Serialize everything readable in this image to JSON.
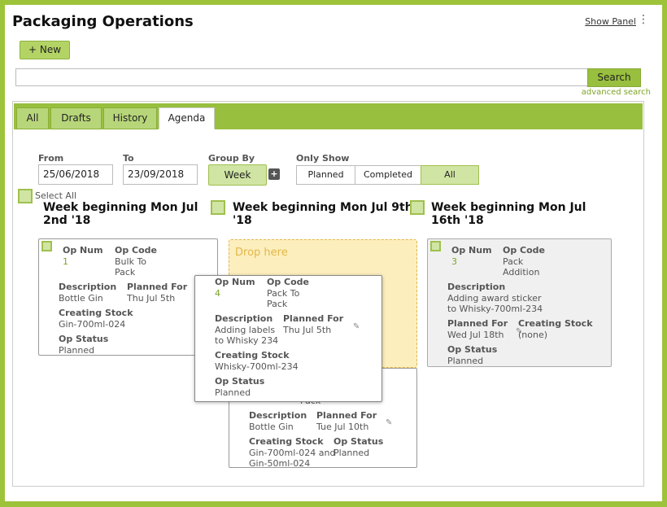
{
  "header": {
    "title": "Packaging Operations",
    "show_panel": "Show Panel",
    "new_label": "+ New"
  },
  "search": {
    "button": "Search",
    "advanced": "advanced search",
    "placeholder": ""
  },
  "tabs": [
    "All",
    "Drafts",
    "History",
    "Agenda"
  ],
  "filters": {
    "from_label": "From",
    "from_value": "25/06/2018",
    "to_label": "To",
    "to_value": "23/09/2018",
    "group_by_label": "Group By",
    "group_by_value": "Week",
    "plus": "+",
    "only_show_label": "Only Show",
    "only_show_options": [
      "Planned",
      "Completed",
      "All"
    ]
  },
  "select_all": "Select All",
  "drop_here": "Drop here",
  "weeks": [
    "Week beginning Mon Jul 2nd '18",
    "Week beginning Mon Jul 9th '18",
    "Week beginning Mon Jul 16th '18"
  ],
  "labels": {
    "op_num": "Op Num",
    "op_code": "Op Code",
    "description": "Description",
    "planned_for": "Planned For",
    "creating_stock": "Creating Stock",
    "op_status": "Op Status"
  },
  "cards": {
    "c1": {
      "num": "1",
      "code": "Bulk To Pack",
      "desc": "Bottle Gin",
      "planned": "Thu Jul 5th",
      "stock": "Gin-700ml-024",
      "status": "Planned"
    },
    "c4": {
      "num": "4",
      "code": "Pack To Pack",
      "desc": "Adding labels to Whisky 234",
      "planned": "Thu Jul 5th",
      "stock": "Whisky-700ml-234",
      "status": "Planned"
    },
    "c2": {
      "code_tail": "Pack",
      "desc": "Bottle Gin",
      "planned": "Tue Jul 10th",
      "stock": "Gin-700ml-024 and Gin-50ml-024",
      "status": "Planned"
    },
    "c3": {
      "num": "3",
      "code": "Pack Addition",
      "desc": "Adding award sticker to Whisky-700ml-234",
      "planned": "Wed Jul 18th",
      "stock": "(none)",
      "status": "Planned"
    }
  },
  "colors": {
    "brand_green": "#98bf3e",
    "light_green": "#d0e5a3",
    "drop_bg": "#fdeebe"
  },
  "icons": {
    "pencil": "✎",
    "kebab": "⋮"
  }
}
